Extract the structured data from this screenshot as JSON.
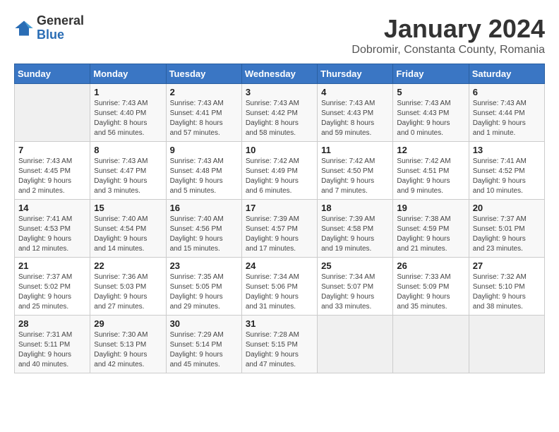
{
  "header": {
    "logo_general": "General",
    "logo_blue": "Blue",
    "title": "January 2024",
    "subtitle": "Dobromir, Constanta County, Romania"
  },
  "days_of_week": [
    "Sunday",
    "Monday",
    "Tuesday",
    "Wednesday",
    "Thursday",
    "Friday",
    "Saturday"
  ],
  "weeks": [
    [
      {
        "day": "",
        "info": ""
      },
      {
        "day": "1",
        "info": "Sunrise: 7:43 AM\nSunset: 4:40 PM\nDaylight: 8 hours\nand 56 minutes."
      },
      {
        "day": "2",
        "info": "Sunrise: 7:43 AM\nSunset: 4:41 PM\nDaylight: 8 hours\nand 57 minutes."
      },
      {
        "day": "3",
        "info": "Sunrise: 7:43 AM\nSunset: 4:42 PM\nDaylight: 8 hours\nand 58 minutes."
      },
      {
        "day": "4",
        "info": "Sunrise: 7:43 AM\nSunset: 4:43 PM\nDaylight: 8 hours\nand 59 minutes."
      },
      {
        "day": "5",
        "info": "Sunrise: 7:43 AM\nSunset: 4:43 PM\nDaylight: 9 hours\nand 0 minutes."
      },
      {
        "day": "6",
        "info": "Sunrise: 7:43 AM\nSunset: 4:44 PM\nDaylight: 9 hours\nand 1 minute."
      }
    ],
    [
      {
        "day": "7",
        "info": "Sunrise: 7:43 AM\nSunset: 4:45 PM\nDaylight: 9 hours\nand 2 minutes."
      },
      {
        "day": "8",
        "info": "Sunrise: 7:43 AM\nSunset: 4:47 PM\nDaylight: 9 hours\nand 3 minutes."
      },
      {
        "day": "9",
        "info": "Sunrise: 7:43 AM\nSunset: 4:48 PM\nDaylight: 9 hours\nand 5 minutes."
      },
      {
        "day": "10",
        "info": "Sunrise: 7:42 AM\nSunset: 4:49 PM\nDaylight: 9 hours\nand 6 minutes."
      },
      {
        "day": "11",
        "info": "Sunrise: 7:42 AM\nSunset: 4:50 PM\nDaylight: 9 hours\nand 7 minutes."
      },
      {
        "day": "12",
        "info": "Sunrise: 7:42 AM\nSunset: 4:51 PM\nDaylight: 9 hours\nand 9 minutes."
      },
      {
        "day": "13",
        "info": "Sunrise: 7:41 AM\nSunset: 4:52 PM\nDaylight: 9 hours\nand 10 minutes."
      }
    ],
    [
      {
        "day": "14",
        "info": "Sunrise: 7:41 AM\nSunset: 4:53 PM\nDaylight: 9 hours\nand 12 minutes."
      },
      {
        "day": "15",
        "info": "Sunrise: 7:40 AM\nSunset: 4:54 PM\nDaylight: 9 hours\nand 14 minutes."
      },
      {
        "day": "16",
        "info": "Sunrise: 7:40 AM\nSunset: 4:56 PM\nDaylight: 9 hours\nand 15 minutes."
      },
      {
        "day": "17",
        "info": "Sunrise: 7:39 AM\nSunset: 4:57 PM\nDaylight: 9 hours\nand 17 minutes."
      },
      {
        "day": "18",
        "info": "Sunrise: 7:39 AM\nSunset: 4:58 PM\nDaylight: 9 hours\nand 19 minutes."
      },
      {
        "day": "19",
        "info": "Sunrise: 7:38 AM\nSunset: 4:59 PM\nDaylight: 9 hours\nand 21 minutes."
      },
      {
        "day": "20",
        "info": "Sunrise: 7:37 AM\nSunset: 5:01 PM\nDaylight: 9 hours\nand 23 minutes."
      }
    ],
    [
      {
        "day": "21",
        "info": "Sunrise: 7:37 AM\nSunset: 5:02 PM\nDaylight: 9 hours\nand 25 minutes."
      },
      {
        "day": "22",
        "info": "Sunrise: 7:36 AM\nSunset: 5:03 PM\nDaylight: 9 hours\nand 27 minutes."
      },
      {
        "day": "23",
        "info": "Sunrise: 7:35 AM\nSunset: 5:05 PM\nDaylight: 9 hours\nand 29 minutes."
      },
      {
        "day": "24",
        "info": "Sunrise: 7:34 AM\nSunset: 5:06 PM\nDaylight: 9 hours\nand 31 minutes."
      },
      {
        "day": "25",
        "info": "Sunrise: 7:34 AM\nSunset: 5:07 PM\nDaylight: 9 hours\nand 33 minutes."
      },
      {
        "day": "26",
        "info": "Sunrise: 7:33 AM\nSunset: 5:09 PM\nDaylight: 9 hours\nand 35 minutes."
      },
      {
        "day": "27",
        "info": "Sunrise: 7:32 AM\nSunset: 5:10 PM\nDaylight: 9 hours\nand 38 minutes."
      }
    ],
    [
      {
        "day": "28",
        "info": "Sunrise: 7:31 AM\nSunset: 5:11 PM\nDaylight: 9 hours\nand 40 minutes."
      },
      {
        "day": "29",
        "info": "Sunrise: 7:30 AM\nSunset: 5:13 PM\nDaylight: 9 hours\nand 42 minutes."
      },
      {
        "day": "30",
        "info": "Sunrise: 7:29 AM\nSunset: 5:14 PM\nDaylight: 9 hours\nand 45 minutes."
      },
      {
        "day": "31",
        "info": "Sunrise: 7:28 AM\nSunset: 5:15 PM\nDaylight: 9 hours\nand 47 minutes."
      },
      {
        "day": "",
        "info": ""
      },
      {
        "day": "",
        "info": ""
      },
      {
        "day": "",
        "info": ""
      }
    ]
  ]
}
